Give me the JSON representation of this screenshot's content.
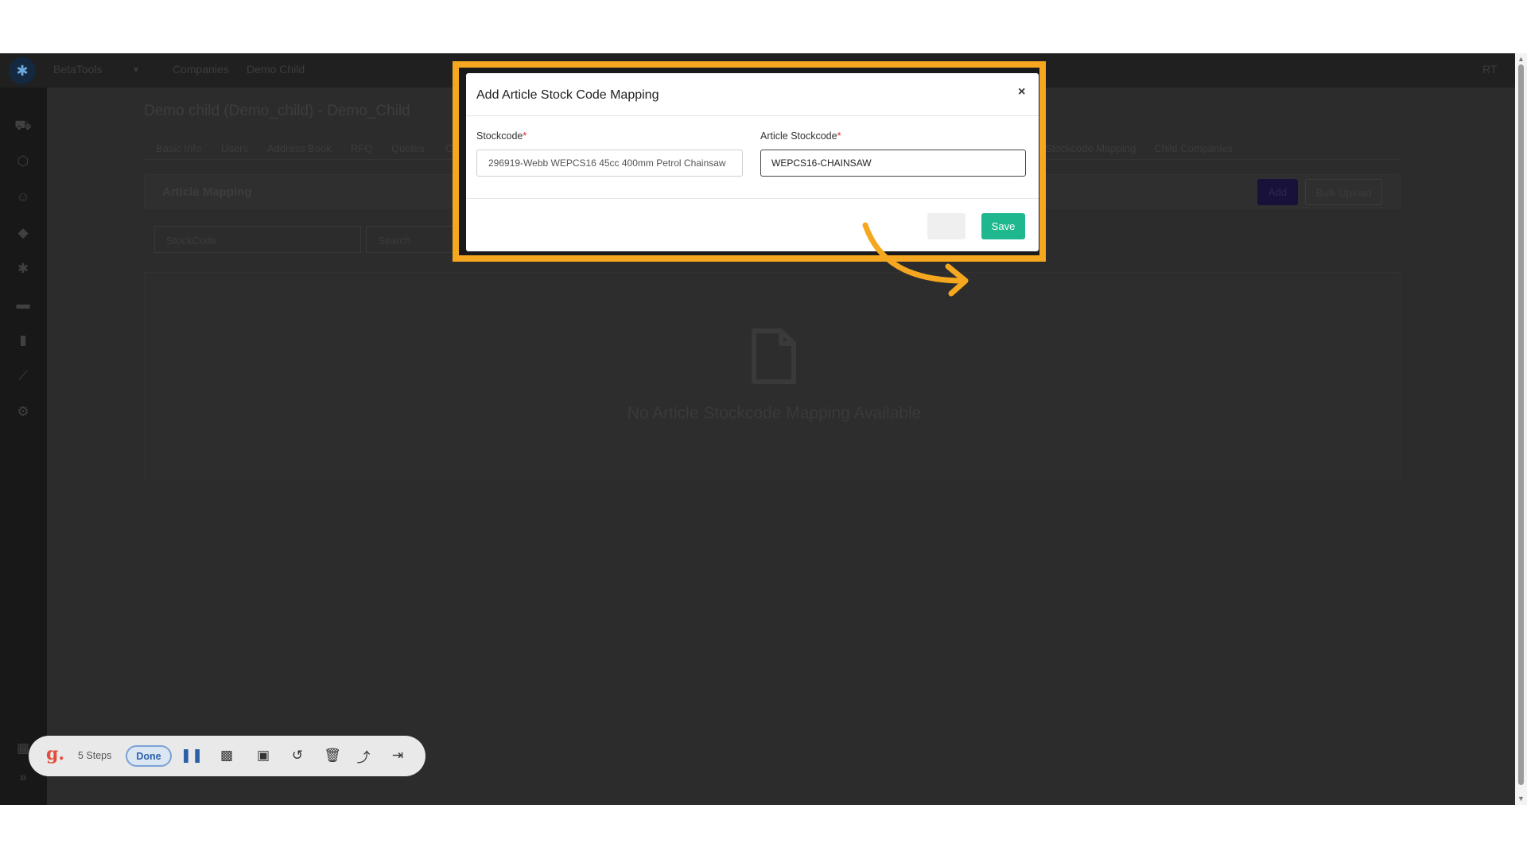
{
  "topbar": {
    "org": "BetaTools",
    "crumb1": "Companies",
    "crumb2": "Demo Child",
    "user": "RT"
  },
  "page": {
    "title": "Demo child (Demo_child) - Demo_Child"
  },
  "tabs": [
    "Basic Info",
    "Users",
    "Address Book",
    "RFQ",
    "Quotes",
    "C",
    "Stockcode Mapping",
    "Child Companies"
  ],
  "card": {
    "title": "Article Mapping",
    "add_label": "Add",
    "bulk_label": "Bulk Upload"
  },
  "filter": {
    "select_value": "StockCode",
    "search_placeholder": "Search"
  },
  "empty": {
    "text": "No Article Stockcode Mapping Available"
  },
  "modal": {
    "title": "Add Article Stock Code Mapping",
    "close": "×",
    "stockcode_label": "Stockcode",
    "stockcode_value": "296919-Webb WEPCS16 45cc 400mm Petrol Chainsaw",
    "article_label": "Article Stockcode",
    "article_value": "WEPCS16-CHAINSAW",
    "required_mark": "*",
    "save_label": "Save"
  },
  "recorder": {
    "logo": "g.",
    "steps": "5 Steps",
    "done_label": "Done"
  },
  "colors": {
    "highlight": "#f5a81f",
    "save": "#1fb88e",
    "required": "#e02424"
  }
}
